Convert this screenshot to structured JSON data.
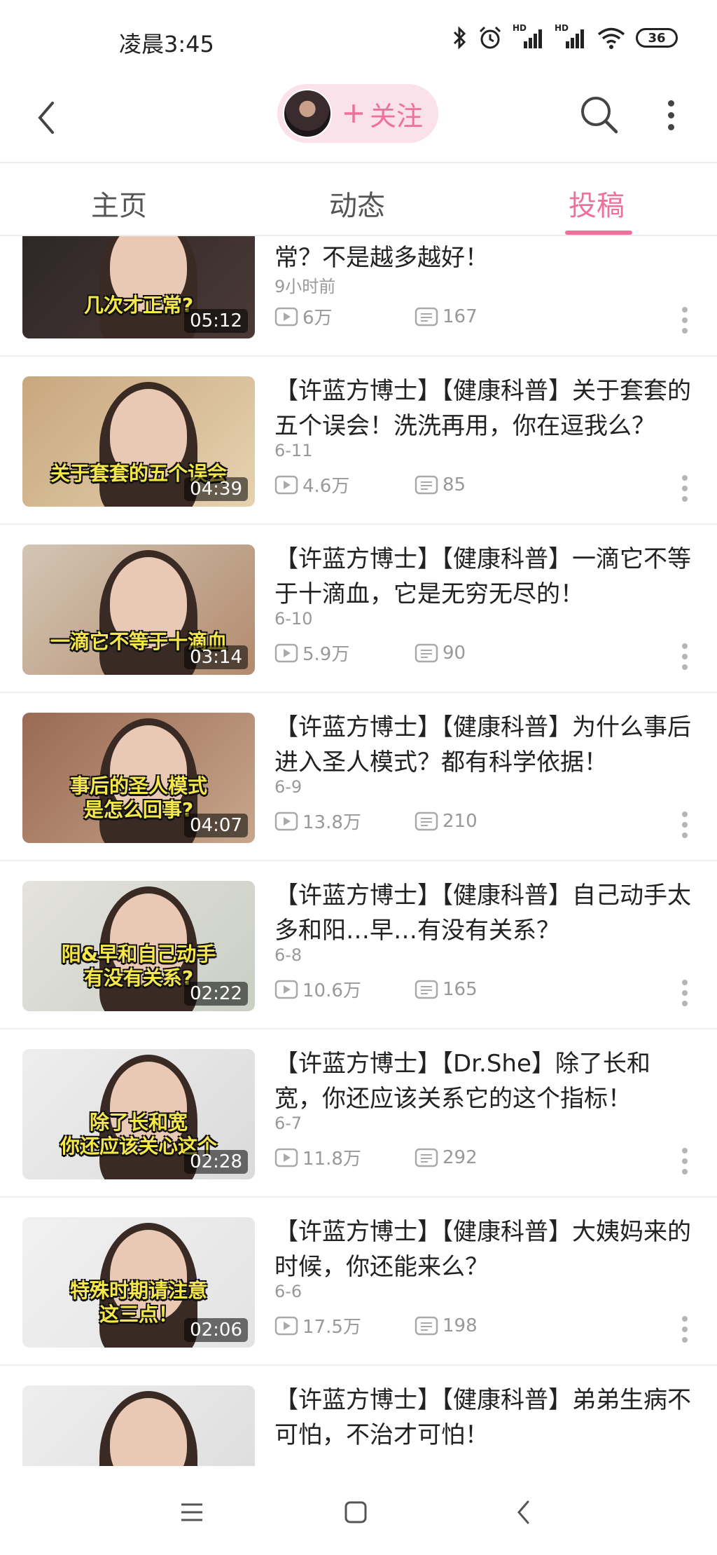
{
  "status_bar": {
    "time": "凌晨3:45",
    "network_label_1": "HD",
    "network_label_2": "HD",
    "battery": "36"
  },
  "header": {
    "follow_label": "关注",
    "follow_icon": "plus-icon"
  },
  "tabs": [
    {
      "label": "主页",
      "active": false
    },
    {
      "label": "动态",
      "active": false
    },
    {
      "label": "投稿",
      "active": true
    }
  ],
  "videos": [
    {
      "title": "【许蓝方博士】【健康科普】几次才正常？不是越多越好！",
      "date": "9小时前",
      "views": "6万",
      "comments": "167",
      "duration": "05:12",
      "caption": "几次才正常?"
    },
    {
      "title": "【许蓝方博士】【健康科普】关于套套的五个误会！洗洗再用，你在逗我么？",
      "date": "6-11",
      "views": "4.6万",
      "comments": "85",
      "duration": "04:39",
      "caption": "关于套套的五个误会"
    },
    {
      "title": "【许蓝方博士】【健康科普】一滴它不等于十滴血，它是无穷无尽的！",
      "date": "6-10",
      "views": "5.9万",
      "comments": "90",
      "duration": "03:14",
      "caption": "一滴它不等于十滴血"
    },
    {
      "title": "【许蓝方博士】【健康科普】为什么事后进入圣人模式？都有科学依据！",
      "date": "6-9",
      "views": "13.8万",
      "comments": "210",
      "duration": "04:07",
      "caption": "事后的圣人模式\n是怎么回事?"
    },
    {
      "title": "【许蓝方博士】【健康科普】自己动手太多和阳…早…有没有关系？",
      "date": "6-8",
      "views": "10.6万",
      "comments": "165",
      "duration": "02:22",
      "caption": "阳&早和自己动手\n有没有关系?"
    },
    {
      "title": "【许蓝方博士】【Dr.She】除了长和宽，你还应该关系它的这个指标！",
      "date": "6-7",
      "views": "11.8万",
      "comments": "292",
      "duration": "02:28",
      "caption": "除了长和宽\n你还应该关心这个"
    },
    {
      "title": "【许蓝方博士】【健康科普】大姨妈来的时候，你还能来么？",
      "date": "6-6",
      "views": "17.5万",
      "comments": "198",
      "duration": "02:06",
      "caption": "特殊时期请注意\n这三点！"
    },
    {
      "title": "【许蓝方博士】【健康科普】弟弟生病不可怕，不治才可怕！",
      "date": "",
      "views": "",
      "comments": "",
      "duration": "",
      "caption": ""
    }
  ],
  "colors": {
    "accent": "#f0709a",
    "follow_bg": "#fbe1ea",
    "caption_yellow": "#f6e84a",
    "meta_gray": "#999999"
  }
}
